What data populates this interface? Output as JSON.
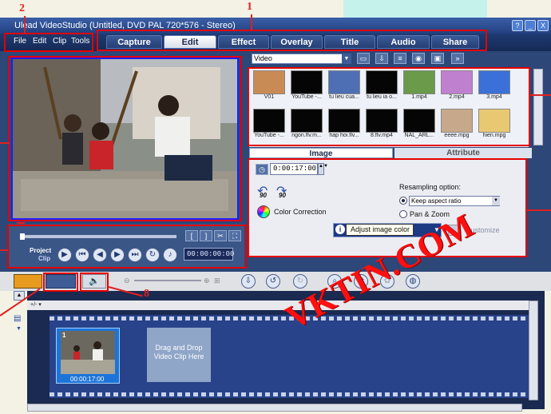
{
  "window": {
    "title": "Ulead VideoStudio (Untitled, DVD PAL 720*576 - Stereo)",
    "buttons": [
      "?",
      "_",
      "X"
    ]
  },
  "menu": [
    "File",
    "Edit",
    "Clip",
    "Tools"
  ],
  "steps": [
    {
      "label": "Capture",
      "active": false
    },
    {
      "label": "Edit",
      "active": true
    },
    {
      "label": "Effect",
      "active": false
    },
    {
      "label": "Overlay",
      "active": false
    },
    {
      "label": "Title",
      "active": false
    },
    {
      "label": "Audio",
      "active": false
    },
    {
      "label": "Share",
      "active": false
    }
  ],
  "library": {
    "category": "Video",
    "items": [
      {
        "label": "V01",
        "color": "#c98b55"
      },
      {
        "label": "YouTube -...",
        "color": "#050505"
      },
      {
        "label": "tu lieu cua...",
        "color": "#4f6fb5"
      },
      {
        "label": "tu lieu ia o...",
        "color": "#050505"
      },
      {
        "label": "1.mp4",
        "color": "#6a9a4a"
      },
      {
        "label": "2.mp4",
        "color": "#c080d0"
      },
      {
        "label": "3.mp4",
        "color": "#3a70d8"
      },
      {
        "label": "YouTube -...",
        "color": "#050505"
      },
      {
        "label": "ngon.flv.m...",
        "color": "#050505"
      },
      {
        "label": "hap hoi.flv...",
        "color": "#050505"
      },
      {
        "label": "8.flv.mp4",
        "color": "#050505"
      },
      {
        "label": "NAL_ARL...",
        "color": "#050505"
      },
      {
        "label": "eeee.mpg",
        "color": "#c8a88a"
      },
      {
        "label": "hien.mpg",
        "color": "#e8c870"
      }
    ]
  },
  "options": {
    "tab_image": "Image",
    "tab_attribute": "Attribute",
    "duration": "0:00:17:00",
    "rotate_left": "90",
    "rotate_right": "90",
    "color_correction": "Color Correction",
    "resampling_label": "Resampling option:",
    "keep_aspect": "Keep aspect ratio",
    "pan_zoom": "Pan & Zoom",
    "tooltip": "Adjust image color",
    "customize": "Customize"
  },
  "player": {
    "project_label": "Project",
    "clip_label": "Clip",
    "timecode": "00:00:00:00"
  },
  "timeline": {
    "clip_timecode": "00:00:17:00",
    "clip_index": "1",
    "drop_hint": "Drag and Drop Video Clip Here",
    "track_label": "+/- ▾"
  },
  "annotations": {
    "n1": "1",
    "n2": "2",
    "n8": "8"
  },
  "watermark": "VKTIN.COM",
  "colors": {
    "annotation": "#e60000",
    "watermark": "#ff1010",
    "accent": "#1d1dff"
  },
  "icons": {
    "preview_marker": "triangle-down-icon",
    "play": "play-icon",
    "home": "go-to-start-icon",
    "prev": "previous-frame-icon",
    "next": "next-frame-icon",
    "end": "go-to-end-icon",
    "repeat": "repeat-icon",
    "volume": "volume-icon"
  }
}
